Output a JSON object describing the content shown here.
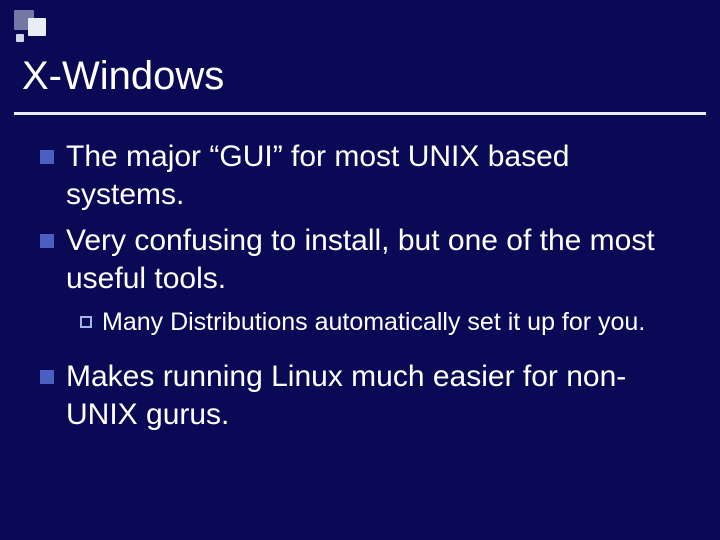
{
  "title": "X-Windows",
  "bullets": {
    "b0": "The major “GUI” for most UNIX based systems.",
    "b1": "Very confusing to install, but one of the most useful tools.",
    "b1_sub0": "Many Distributions automatically set it up for you.",
    "b2": "Makes running Linux much easier for non-UNIX gurus."
  }
}
